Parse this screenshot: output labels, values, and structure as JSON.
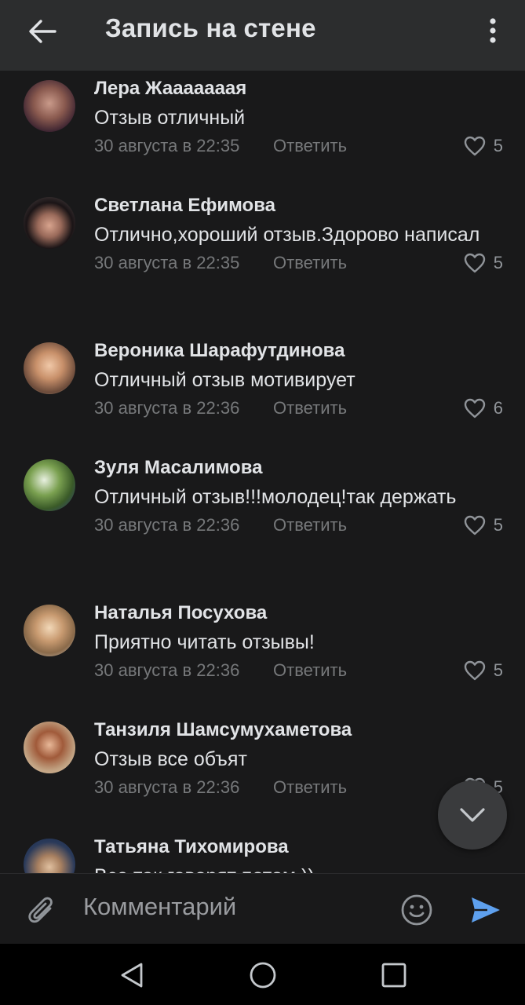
{
  "header": {
    "title": "Запись на стене",
    "back_icon": "arrow-left-icon",
    "menu_icon": "more-vertical-icon"
  },
  "comments": [
    {
      "author": "Лера Жааааааая",
      "text": "Отзыв отличный",
      "date": "30 августа в 22:35",
      "reply": "Ответить",
      "likes": "5"
    },
    {
      "author": "Светлана Ефимова",
      "text": "Отлично,хороший отзыв.Здорово написал",
      "date": "30 августа в 22:35",
      "reply": "Ответить",
      "likes": "5"
    },
    {
      "author": "Вероника Шарафутдинова",
      "text": "Отличный отзыв мотивирует",
      "date": "30 августа в 22:36",
      "reply": "Ответить",
      "likes": "6"
    },
    {
      "author": "Зуля Масалимова",
      "text": "Отличный отзыв!!!молодец!так держать",
      "date": "30 августа в 22:36",
      "reply": "Ответить",
      "likes": "5"
    },
    {
      "author": "Наталья Посухова",
      "text": "Приятно читать отзывы!",
      "date": "30 августа в 22:36",
      "reply": "Ответить",
      "likes": "5"
    },
    {
      "author": "Танзиля Шамсумухаметова",
      "text": "Отзыв все объят",
      "date": "30 августа в 22:36",
      "reply": "Ответить",
      "likes": "5"
    },
    {
      "author": "Татьяна Тихомирова",
      "text": "Все так говорят потом ))",
      "date": "",
      "reply": "",
      "likes": ""
    }
  ],
  "composer": {
    "placeholder": "Комментарий",
    "attach_icon": "paperclip-icon",
    "emoji_icon": "smile-icon",
    "send_icon": "send-icon"
  },
  "scroll_down_icon": "chevron-down-icon",
  "colors": {
    "background": "#19191a",
    "appbar": "#2c2d2e",
    "text": "#e1e3e6",
    "secondary": "#76787a",
    "accent": "#5ea0ee"
  },
  "system_nav": {
    "back_icon": "nav-back-triangle-icon",
    "home_icon": "nav-home-circle-icon",
    "recents_icon": "nav-recents-square-icon"
  }
}
